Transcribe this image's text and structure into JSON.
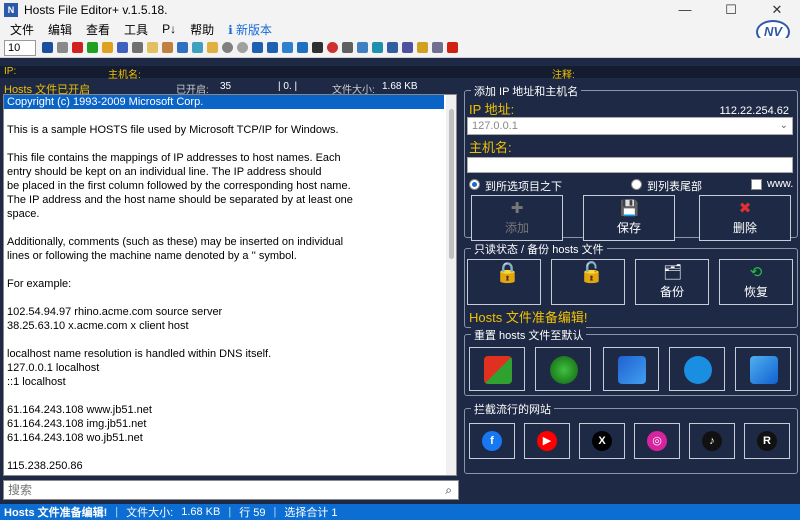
{
  "window": {
    "title": "Hosts File Editor+ v.1.5.18.",
    "app_icon_text": "N"
  },
  "menu": [
    {
      "label": "文件"
    },
    {
      "label": "编辑"
    },
    {
      "label": "查看"
    },
    {
      "label": "工具"
    },
    {
      "label": "P↓"
    },
    {
      "label": "帮助"
    },
    {
      "label": "新版本"
    }
  ],
  "toolbar": {
    "zoom_value": "10",
    "logo_text": "NV"
  },
  "info": {
    "ip_label": "IP:",
    "host_label": "主机名:",
    "comment_label": "注释:"
  },
  "status": {
    "hosts_state": "Hosts 文件已开启",
    "enabled_label": "已开启:",
    "enabled_count": "35",
    "disabled_count": "| 0. |",
    "size_label": "文件大小:",
    "size_value": "1.68 KB"
  },
  "editor": {
    "lines": [
      "Copyright (c) 1993-2009 Microsoft Corp.",
      "",
      "This is a sample HOSTS file used by Microsoft TCP/IP for Windows.",
      "",
      "This file contains the mappings of IP addresses to host names. Each",
      "entry should be kept on an individual line. The IP address should",
      "be placed in the first column followed by the corresponding host name.",
      "The IP address and the host name should be separated by at least one",
      "space.",
      "",
      "Additionally, comments (such as these) may be inserted on individual",
      "lines or following the machine name denoted by a '' symbol.",
      "",
      "For example:",
      "",
      "102.54.94.97 rhino.acme.com source server",
      "38.25.63.10 x.acme.com x client host",
      "",
      "localhost name resolution is handled within DNS itself.",
      "127.0.0.1 localhost",
      "::1 localhost",
      "",
      "61.164.243.108 www.jb51.net",
      "61.164.243.108 img.jb51.net",
      "61.164.243.108 wo.jb51.net",
      "",
      "115.238.250.86"
    ]
  },
  "search": {
    "placeholder": "搜索"
  },
  "bottom": {
    "state": "Hosts 文件准备编辑!",
    "size_label": "文件大小:",
    "size_value": "1.68 KB",
    "line": "行 59",
    "selection": "选择合计 1"
  },
  "add_group": {
    "title": "添加 IP 地址和主机名",
    "ip_label": "IP 地址:",
    "ip_display": "112.22.254.62",
    "ip_placeholder": "127.0.0.1",
    "host_label": "主机名:",
    "radio_selected": "到所选项目之下",
    "radio_end": "到列表尾部",
    "checkbox_www": "www.",
    "add": "添加",
    "save": "保存",
    "delete": "删除"
  },
  "backup_group": {
    "title": "只读状态 / 备份 hosts 文件",
    "backup": "备份",
    "restore": "恢复",
    "status": "Hosts 文件准备编辑!"
  },
  "reset_group": {
    "title": "重置 hosts 文件至默认"
  },
  "block_group": {
    "title": "拦截流行的网站",
    "sites": [
      {
        "icon": "facebook-icon",
        "glyph": "f",
        "color": "#1877f2"
      },
      {
        "icon": "youtube-icon",
        "glyph": "▶",
        "color": "#ff0000"
      },
      {
        "icon": "x-icon",
        "glyph": "X",
        "color": "#000000"
      },
      {
        "icon": "instagram-icon",
        "glyph": "◎",
        "color": "#d6249f"
      },
      {
        "icon": "tiktok-icon",
        "glyph": "♪",
        "color": "#111111"
      },
      {
        "icon": "reddit-icon",
        "glyph": "R",
        "color": "#111111"
      }
    ]
  },
  "colors": {
    "accent": "#0c6ed2",
    "panel": "#1e2a45",
    "label_yellow": "#f0c000"
  }
}
